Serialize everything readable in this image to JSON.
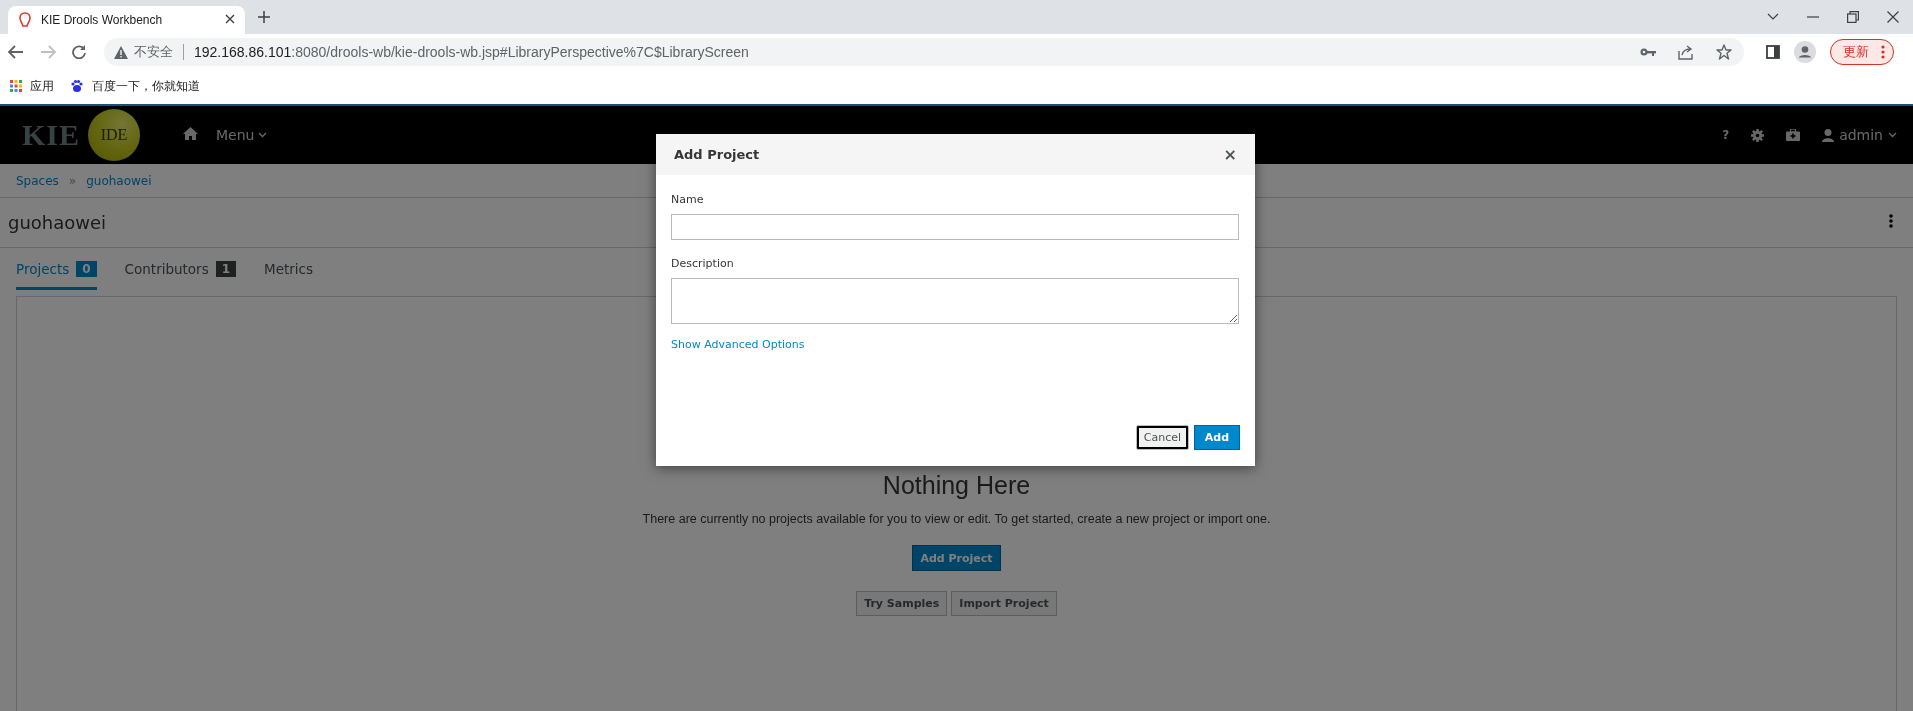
{
  "browser": {
    "tab": {
      "title": "KIE Drools Workbench"
    },
    "address": {
      "security": "不安全",
      "host": "192.168.86.101",
      "path": ":8080/drools-wb/kie-drools-wb.jsp#LibraryPerspective%7C$LibraryScreen"
    },
    "forward_button": {
      "disabled": true
    },
    "update_button": "更新",
    "bookmarks": [
      {
        "label": "应用",
        "kind": "apps"
      },
      {
        "label": "百度一下，你就知道",
        "kind": "site"
      }
    ]
  },
  "header": {
    "logo": "KIE",
    "logo_badge": "IDE",
    "menu": "Menu",
    "help": "?",
    "user": "admin"
  },
  "breadcrumbs": {
    "items": [
      "Spaces",
      "guohaowei"
    ],
    "separator": "»"
  },
  "space_title": "guohaowei",
  "tabs": [
    {
      "label": "Projects",
      "count": "0",
      "selected": true
    },
    {
      "label": "Contributors",
      "count": "1",
      "selected": false
    },
    {
      "label": "Metrics",
      "selected": false
    }
  ],
  "empty_state": {
    "title": "Nothing Here",
    "message": "There are currently no projects available for you to view or edit. To get started, create a new project or import one.",
    "primary_button": "Add Project",
    "buttons": [
      "Try Samples",
      "Import Project"
    ]
  },
  "dialog": {
    "title": "Add Project",
    "close": "×",
    "fields": [
      {
        "label": "Name",
        "kind": "input"
      },
      {
        "label": "Description",
        "kind": "textarea"
      }
    ],
    "link": "Show Advanced Options",
    "buttons": [
      {
        "label": "Cancel",
        "kind": "default",
        "focused": true
      },
      {
        "label": "Add",
        "kind": "primary",
        "focused": false
      }
    ]
  }
}
